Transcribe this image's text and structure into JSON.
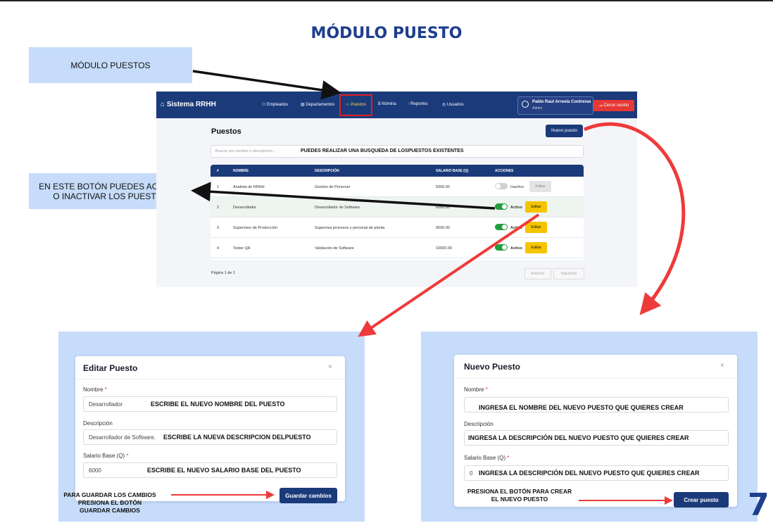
{
  "title": "MÓDULO PUESTO",
  "callouts": {
    "module": "MÓDULO PUESTOS",
    "toggle_line1": "EN ESTE BOTÓN PUEDES ACTIVAR",
    "toggle_line2": "O INACTIVAR LOS PUESTOS"
  },
  "app": {
    "brand": "Sistema RRHH",
    "nav": [
      "Empleados",
      "Departamentos",
      "Puestos",
      "Nómina",
      "Reportes",
      "Usuarios"
    ],
    "user_name": "Pablo Raul Arreola Contreras",
    "user_role": "Admin",
    "logout": "Cerrar sesión",
    "page_title": "Puestos",
    "new_button": "Nuevo puesto",
    "search_placeholder": "Buscar por nombre o descripción...",
    "search_note": "PUEDES REALIZAR UNA BUSQUEDA DE LOSPUESTOS EXISTENTES",
    "columns": [
      "#",
      "NOMBRE",
      "DESCRIPCIÓN",
      "SALARIO BASE (Q)",
      "ACCIONES"
    ],
    "rows": [
      {
        "id": "1",
        "name": "Analista de RRHH",
        "desc": "Gestion de Personal",
        "salary": "5000.00",
        "status": "Inactivo",
        "edit": "Editar"
      },
      {
        "id": "2",
        "name": "Desarrollador",
        "desc": "Desarrollador de Software.",
        "salary": "6000.00",
        "status": "Activo",
        "edit": "Editar"
      },
      {
        "id": "3",
        "name": "Supervisor de Producción",
        "desc": "Supervisa procesos y personal de planta",
        "salary": "9500.00",
        "status": "Activo",
        "edit": "Editar"
      },
      {
        "id": "4",
        "name": "Tester QA",
        "desc": "Validación de Software",
        "salary": "10000.00",
        "status": "Activo",
        "edit": "Editar"
      }
    ],
    "pager": "Página 1 de 1",
    "prev": "Anterior",
    "next": "Siguiente"
  },
  "edit_modal": {
    "title": "Editar Puesto",
    "close": "×",
    "name_label": "Nombre",
    "name_value": "Desarrollador",
    "name_note": "ESCRIBE EL NUEVO NOMBRE DEL PUESTO",
    "desc_label": "Descripción",
    "desc_value": "Desarrollador de Software.",
    "desc_note": "ESCRIBE LA NUEVA DESCRIPCION DELPUESTO",
    "salary_label": "Salario Base (Q)",
    "salary_value": "6000",
    "salary_note": "ESCRIBE EL NUEVO SALARIO BASE DEL PUESTO",
    "save_button": "Guardar cambios",
    "save_note_1": "PARA GUARDAR LOS CAMBIOS",
    "save_note_2": "PRESIONA EL BOTÓN",
    "save_note_3": "GUARDAR CAMBIOS"
  },
  "new_modal": {
    "title": "Nuevo Puesto",
    "close": "×",
    "name_label": "Nombre",
    "name_note": "INGRESA EL NOMBRE DEL NUEVO PUESTO QUE QUIERES CREAR",
    "desc_label": "Descripción",
    "desc_note": "INGRESA LA DESCRIPCIÓN DEL NUEVO PUESTO QUE QUIERES CREAR",
    "salary_label": "Salario Base (Q)",
    "salary_value": "0",
    "salary_note": "INGRESA LA DESCRIPCIÓN DEL NUEVO PUESTO QUE QUIERES CREAR",
    "create_button": "Crear puesto",
    "create_note_1": "PRESIONA EL BOTÓN PARA CREAR",
    "create_note_2": "EL NUEVO PUESTO"
  },
  "required_mark": "*",
  "page_number": "7",
  "colors": {
    "primary": "#1b3a7a",
    "accent": "#f5c400",
    "danger": "#e53935",
    "callout_bg": "#c6dcfa"
  }
}
